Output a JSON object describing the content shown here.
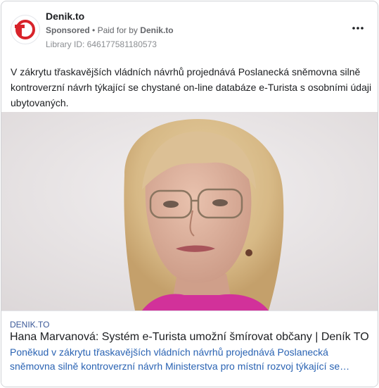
{
  "post": {
    "page_name": "Denik.to",
    "sponsored_label": "Sponsored",
    "separator": "•",
    "paid_for_prefix": "Paid for by",
    "payer": "Denik.to",
    "library_id": "Library ID: 646177581180573",
    "more_icon": "more-horizontal-icon",
    "body_text": "V zákrytu třaskavějších vládních návrhů projednává Poslanecká sněmovna silně kontroverzní návrh týkající se chystané on-line databáze e-Turista s osobními údaji ubytovaných."
  },
  "logo": {
    "text": "TO",
    "brand_color": "#d8232a"
  },
  "link_preview": {
    "domain": "DENIK.TO",
    "title": "Hana Marvanová: Systém e-Turista umožní šmírovat občany | Deník TO",
    "description": "Poněkud v zákrytu třaskavějších vládních návrhů projednává Poslanecká sněmovna silně kontroverzní návrh Ministerstva pro místní rozvoj týkající se…",
    "link_color": "#2a63b3"
  }
}
